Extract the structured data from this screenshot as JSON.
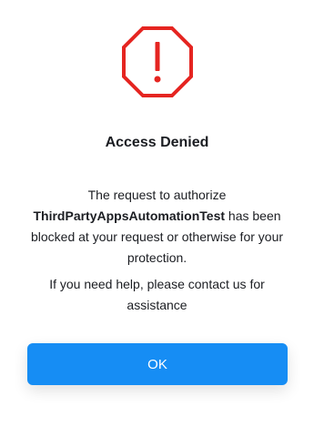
{
  "dialog": {
    "title": "Access Denied",
    "message_prefix": "The request to authorize",
    "app_name": "ThirdPartyAppsAutomationTest",
    "message_suffix": "has been blocked at your request or otherwise for your protection.",
    "help_text": "If you need help, please contact us for assistance",
    "ok_label": "OK"
  },
  "icons": {
    "status_icon": "stop-octagon-exclamation-icon"
  },
  "colors": {
    "alert_red": "#e52521",
    "primary_button": "#168df4",
    "text": "#1b1d22"
  }
}
